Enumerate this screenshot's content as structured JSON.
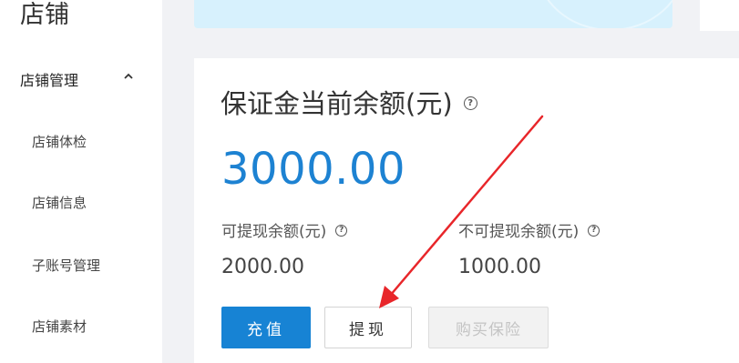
{
  "sidebar": {
    "title": "店铺",
    "group": {
      "label": "店铺管理",
      "icon": "chevron-up-icon"
    },
    "items": [
      {
        "label": "店铺体检"
      },
      {
        "label": "店铺信息"
      },
      {
        "label": "子账号管理"
      },
      {
        "label": "店铺素材"
      }
    ]
  },
  "deposit": {
    "heading": "保证金当前余额(元)",
    "amount": "3000.00",
    "withdrawable_label": "可提现余额(元)",
    "withdrawable_value": "2000.00",
    "non_withdrawable_label": "不可提现余额(元)",
    "non_withdrawable_value": "1000.00",
    "help_glyph": "?"
  },
  "actions": {
    "recharge": "充值",
    "withdraw": "提现",
    "buy_insurance": "购买保险"
  },
  "colors": {
    "accent": "#1783d4",
    "amount": "#1d82d2",
    "annotation_arrow": "#e8262a",
    "banner": "#d7f1fd"
  }
}
